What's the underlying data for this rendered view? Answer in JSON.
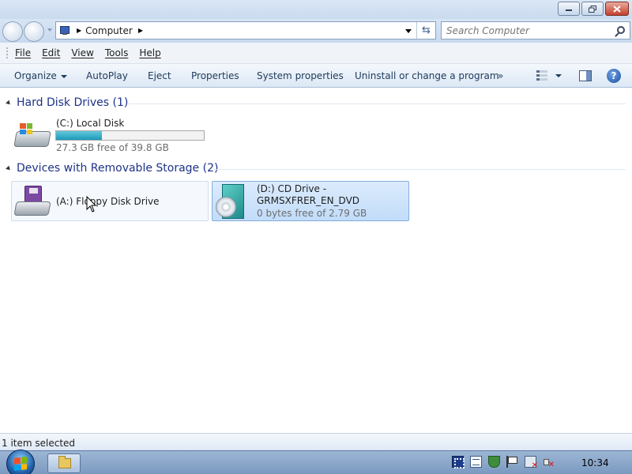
{
  "window": {
    "minimize_icon": "minimize-icon",
    "maximize_icon": "restore-icon",
    "close_icon": "close-icon"
  },
  "address": {
    "breadcrumb": [
      "Computer"
    ],
    "search_placeholder": "Search Computer"
  },
  "menu": [
    "File",
    "Edit",
    "View",
    "Tools",
    "Help"
  ],
  "toolbar": {
    "organize": "Organize",
    "autoplay": "AutoPlay",
    "eject": "Eject",
    "properties": "Properties",
    "system_properties": "System properties",
    "uninstall": "Uninstall or change a program",
    "more": "»"
  },
  "groups": [
    {
      "title": "Hard Disk Drives (1)",
      "drives": [
        {
          "name": "(C:) Local Disk",
          "free_text": "27.3 GB free of 39.8 GB",
          "used_fraction": 0.31,
          "bar_color": "#1b9ab8"
        }
      ]
    },
    {
      "title": "Devices with Removable Storage (2)",
      "drives": [
        {
          "name": "(A:) Floppy Disk Drive",
          "selected": false
        },
        {
          "name_line1": "(D:) CD Drive -",
          "name_line2": "GRMSXFRER_EN_DVD",
          "free_text": "0 bytes free of 2.79 GB",
          "selected": true
        }
      ]
    }
  ],
  "status": {
    "text": "1 item selected"
  },
  "taskbar": {
    "clock": "10:34"
  },
  "colors": {
    "group_title": "#1e3287",
    "selection": "#c1dcfa",
    "accent": "#1b9ab8"
  }
}
